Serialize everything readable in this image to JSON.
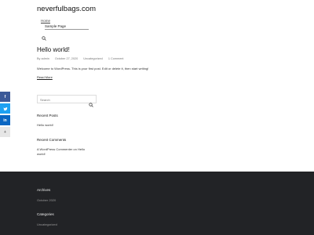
{
  "site": {
    "title": "neverfulbags.com"
  },
  "nav": {
    "items": [
      {
        "label": "Home"
      },
      {
        "label": "Sample Page"
      }
    ]
  },
  "post": {
    "title": "Hello world!",
    "meta": {
      "author": "By admin",
      "date": "October 27, 2020",
      "category": "Uncategorized",
      "comments": "1 Comment"
    },
    "excerpt": "Welcome to WordPress. This is your first post. Edit or delete it, then start writing!",
    "read_more": "Read More"
  },
  "sidebar": {
    "search": {
      "placeholder": "Search",
      "value": ""
    },
    "recent_posts": {
      "title": "Recent Posts",
      "items": [
        "Hello world!"
      ]
    },
    "recent_comments": {
      "title": "Recent Comments",
      "author": "A WordPress Commenter",
      "connector": "on",
      "post_line1": "Hello",
      "post_line2": "world!"
    }
  },
  "social": {
    "icons": [
      "facebook-icon",
      "twitter-icon",
      "linkedin-icon",
      "plus-icon"
    ],
    "labels": {
      "facebook": "f",
      "linkedin": "in",
      "more": "+"
    }
  },
  "footer": {
    "archives": {
      "title": "Archives",
      "items": [
        "October 2020"
      ]
    },
    "categories": {
      "title": "Categories",
      "items": [
        "Uncategorized"
      ]
    },
    "background": "#222326"
  }
}
